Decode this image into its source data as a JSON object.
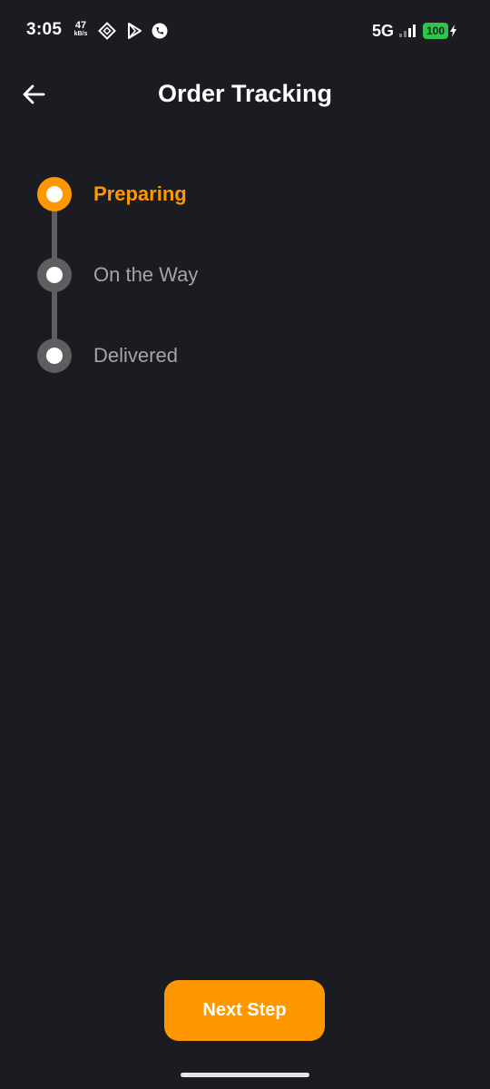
{
  "status_bar": {
    "time": "3:05",
    "net_speed_value": "47",
    "net_speed_unit": "kB/s",
    "icons": [
      "diamond-icon",
      "play-store-icon",
      "phone-app-icon"
    ],
    "network_type": "5G",
    "signal_bars": 4,
    "signal_strength": 2,
    "battery": "100",
    "charging": true,
    "battery_color": "#2ec44e"
  },
  "app_bar": {
    "back_icon": "arrow-left-icon",
    "title": "Order Tracking"
  },
  "stepper": {
    "active_index": 0,
    "active_color": "#ff9800",
    "inactive_color": "#5e5e61",
    "steps": [
      {
        "label": "Preparing",
        "state": "active"
      },
      {
        "label": "On the Way",
        "state": "pending"
      },
      {
        "label": "Delivered",
        "state": "pending"
      }
    ]
  },
  "actions": {
    "next_label": "Next Step",
    "accent": "#ff9800"
  }
}
